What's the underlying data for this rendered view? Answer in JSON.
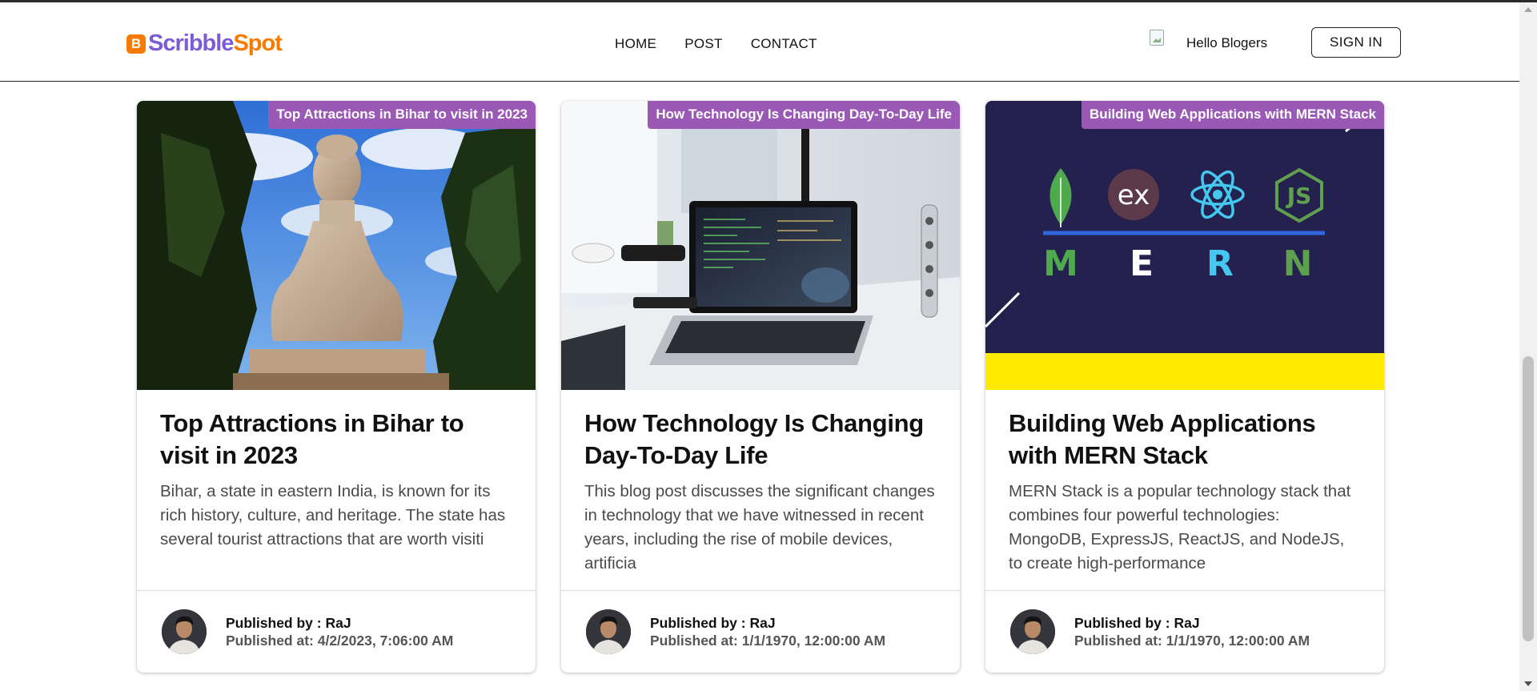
{
  "brand": {
    "mark": "B",
    "name_part1": "Scribble",
    "name_part2": "Spot"
  },
  "nav": {
    "home": "HOME",
    "post": "POST",
    "contact": "CONTACT"
  },
  "user": {
    "greeting": "Hello Blogers",
    "sign_in": "SIGN IN"
  },
  "posts": [
    {
      "tag": "Top Attractions in Bihar to visit in 2023",
      "title": "Top Attractions in Bihar to visit in 2023",
      "excerpt": "Bihar, a state in eastern India, is known for its rich history, culture, and heritage. The state has several tourist attractions that are worth visiti",
      "published_by": "Published by : RaJ",
      "published_at": "Published at: 4/2/2023, 7:06:00 AM"
    },
    {
      "tag": "How Technology Is Changing Day-To-Day Life",
      "title": "How Technology Is Changing Day-To-Day Life",
      "excerpt": "This blog post discusses the significant changes in technology that we have witnessed in recent years, including the rise of mobile devices, artificia",
      "published_by": "Published by : RaJ",
      "published_at": "Published at: 1/1/1970, 12:00:00 AM"
    },
    {
      "tag": "Building Web Applications with MERN Stack",
      "title": "Building Web Applications with MERN Stack",
      "excerpt": "MERN Stack is a popular technology stack that combines four powerful technologies: MongoDB, ExpressJS, ReactJS, and NodeJS, to create high-performance",
      "published_by": "Published by : RaJ",
      "published_at": "Published at: 1/1/1970, 12:00:00 AM"
    }
  ],
  "mern_graphic": {
    "letters": [
      "M",
      "E",
      "R",
      "N"
    ],
    "ex_badge": "ex",
    "js_badge": "JS"
  },
  "colors": {
    "tag_purple": "#9b59b6",
    "brand_orange": "#f57c00",
    "brand_purple": "#7b5cd6",
    "mern_navy": "#25214f",
    "mern_yellow": "#ffeb00"
  },
  "icons": [
    "broken-image-icon",
    "scroll-up-arrow-icon",
    "scroll-down-arrow-icon"
  ]
}
